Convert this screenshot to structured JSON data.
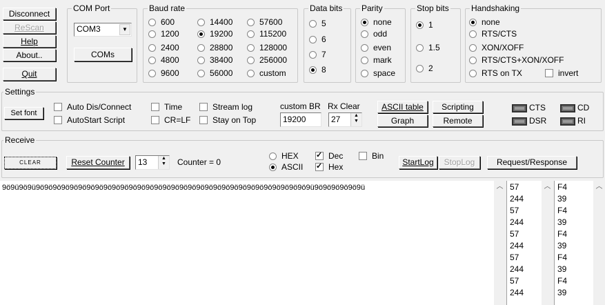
{
  "left_buttons": {
    "disconnect": "Disconnect",
    "rescan": "ReScan",
    "help": "Help",
    "about": "About..",
    "quit": "Quit"
  },
  "com_port": {
    "label": "COM Port",
    "selected": "COM3",
    "coms_button": "COMs"
  },
  "baud_rate": {
    "label": "Baud rate",
    "options": [
      "600",
      "1200",
      "2400",
      "4800",
      "9600",
      "14400",
      "19200",
      "28800",
      "38400",
      "56000",
      "57600",
      "115200",
      "128000",
      "256000",
      "custom"
    ],
    "selected": "19200"
  },
  "data_bits": {
    "label": "Data bits",
    "options": [
      "5",
      "6",
      "7",
      "8"
    ],
    "selected": "8"
  },
  "parity": {
    "label": "Parity",
    "options": [
      "none",
      "odd",
      "even",
      "mark",
      "space"
    ],
    "selected": "none"
  },
  "stop_bits": {
    "label": "Stop bits",
    "options": [
      "1",
      "1.5",
      "2"
    ],
    "selected": "1"
  },
  "handshaking": {
    "label": "Handshaking",
    "options": [
      "none",
      "RTS/CTS",
      "XON/XOFF",
      "RTS/CTS+XON/XOFF",
      "RTS on TX"
    ],
    "selected": "none",
    "invert_label": "invert",
    "invert_checked": false
  },
  "settings": {
    "label": "Settings",
    "set_font": "Set font",
    "auto_dis_connect": "Auto Dis/Connect",
    "autostart_script": "AutoStart Script",
    "time": "Time",
    "cr_lf": "CR=LF",
    "stream_log": "Stream log",
    "stay_on_top": "Stay on Top",
    "custom_br_label": "custom BR",
    "custom_br_value": "19200",
    "rx_clear_label": "Rx Clear",
    "rx_clear_value": "27",
    "ascii_table": "ASCII table",
    "graph": "Graph",
    "scripting": "Scripting",
    "remote": "Remote",
    "leds": [
      "CTS",
      "CD",
      "DSR",
      "RI"
    ]
  },
  "receive": {
    "label": "Receive",
    "clear": "CLEAR",
    "reset_counter": "Reset Counter",
    "counter_spin_value": "13",
    "counter_text": "Counter = 0",
    "hex_label": "HEX",
    "ascii_label": "ASCII",
    "format_selected": "ASCII",
    "dec_label": "Dec",
    "dec_checked": true,
    "bin_label": "Bin",
    "bin_checked": false,
    "hex_check_label": "Hex",
    "hex_checked": true,
    "startlog": "StartLog",
    "stoplog": "StopLog",
    "request_response": "Request/Response"
  },
  "terminal": {
    "text": "9ö9ü9ö9ü9ö9ö9ö9ö9ö9ö9ö9ö9ö9ö9ö9ö9ö9ö9ö9ö9ö9ö9ö9ö9ö9ö9ö9ö9ö9ö9ö9ö9ö9ö9ö9ö9ü9ö9ö9ö9ö9ö9ü",
    "dec_values": [
      "57",
      "244",
      "57",
      "244",
      "57",
      "244",
      "57",
      "244",
      "57",
      "244"
    ],
    "hex_values": [
      "F4",
      "39",
      "F4",
      "39",
      "F4",
      "39",
      "F4",
      "39",
      "F4",
      "39"
    ]
  }
}
